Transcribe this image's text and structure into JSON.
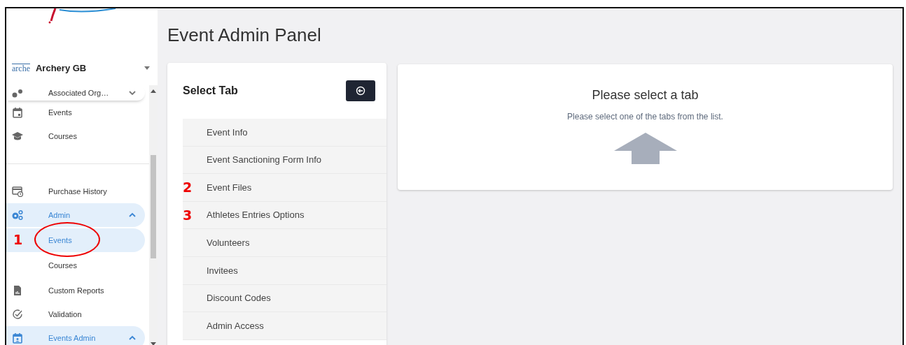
{
  "org_switcher": {
    "logo_text": "arche",
    "name": "Archery GB"
  },
  "sidebar": {
    "sections": [
      {
        "items": [
          {
            "label": "Associated Org…",
            "selected": false,
            "expanded": false
          },
          {
            "label": "Events",
            "selected": false
          },
          {
            "label": "Courses",
            "selected": false
          }
        ]
      },
      {
        "items": [
          {
            "label": "Purchase History",
            "selected": false
          },
          {
            "label": "Admin",
            "selected": true,
            "expanded": true,
            "children": [
              {
                "label": "Events",
                "selected": true,
                "annotation": "1"
              },
              {
                "label": "Courses",
                "selected": false
              }
            ]
          },
          {
            "label": "Custom Reports",
            "selected": false
          },
          {
            "label": "Validation",
            "selected": false
          },
          {
            "label": "Events Admin",
            "selected": true,
            "expanded": true
          }
        ]
      }
    ]
  },
  "page_title": "Event Admin Panel",
  "tab_panel": {
    "title": "Select Tab",
    "tabs": [
      {
        "label": "Event Info",
        "selected": false
      },
      {
        "label": "Event Sanctioning Form Info",
        "selected": false
      },
      {
        "label": "Event Files",
        "selected": false,
        "annotation": "2"
      },
      {
        "label": "Athletes Entries Options",
        "selected": false,
        "annotation": "3"
      },
      {
        "label": "Volunteers",
        "selected": false
      },
      {
        "label": "Invitees",
        "selected": false
      },
      {
        "label": "Discount Codes",
        "selected": false
      },
      {
        "label": "Admin Access",
        "selected": false
      }
    ]
  },
  "content": {
    "title": "Please select a tab",
    "message": "Please select one of the tabs from the list."
  }
}
